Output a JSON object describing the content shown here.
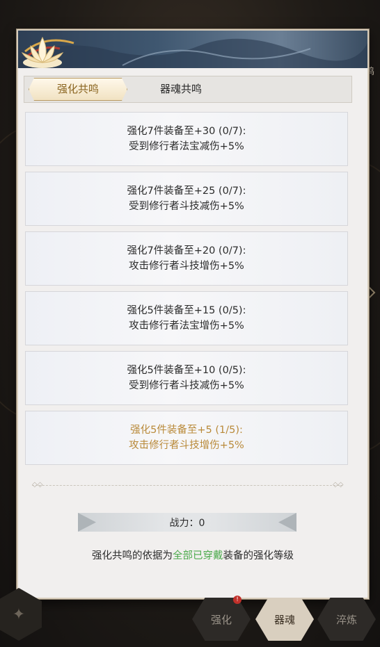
{
  "side": {
    "tab_fragment": "共鸣"
  },
  "tabs": [
    {
      "label": "强化共鸣",
      "active": true
    },
    {
      "label": "器魂共鸣",
      "active": false
    }
  ],
  "resonance_items": [
    {
      "line1": "强化7件装备至+30 (0/7):",
      "line2": "受到修行者法宝减伤+5%",
      "achieved": false
    },
    {
      "line1": "强化7件装备至+25 (0/7):",
      "line2": "受到修行者斗技减伤+5%",
      "achieved": false
    },
    {
      "line1": "强化7件装备至+20 (0/7):",
      "line2": "攻击修行者斗技增伤+5%",
      "achieved": false
    },
    {
      "line1": "强化5件装备至+15 (0/5):",
      "line2": "攻击修行者法宝增伤+5%",
      "achieved": false
    },
    {
      "line1": "强化5件装备至+10 (0/5):",
      "line2": "受到修行者斗技减伤+5%",
      "achieved": false
    },
    {
      "line1": "强化5件装备至+5 (1/5):",
      "line2": "攻击修行者斗技增伤+5%",
      "achieved": true
    }
  ],
  "power": {
    "text": "战力：0"
  },
  "footnote": {
    "before": "强化共鸣的依据为",
    "highlight": "全部已穿戴",
    "after": "装备的强化等级"
  },
  "bottom_nav": [
    {
      "label": "强化",
      "active": false,
      "badge": "!"
    },
    {
      "label": "器魂",
      "active": true
    },
    {
      "label": "淬炼",
      "active": false
    }
  ],
  "colors": {
    "achieved_text": "#b98a3a",
    "highlight_text": "#4caa4c",
    "active_tab_text": "#8a6520"
  }
}
